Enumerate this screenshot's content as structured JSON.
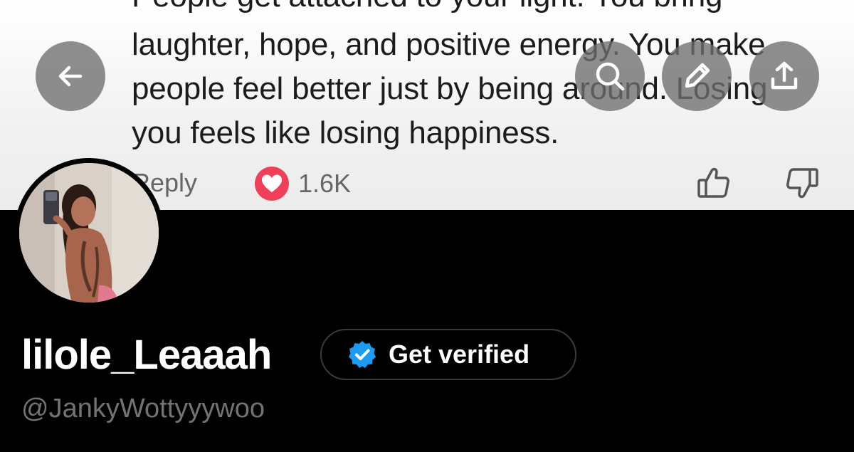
{
  "comment": {
    "lines": [
      "People get attached to your light. You bring",
      "laughter, hope, and positive energy. You make",
      "people feel better just by being around. Losing",
      "you feels like losing happiness."
    ],
    "reply_label": "Reply",
    "like_count": "1.6K",
    "heart_color": "#ef4059"
  },
  "header_actions": {
    "back_icon": "arrow-left-icon",
    "search_icon": "search-icon",
    "edit_icon": "pencil-icon",
    "share_icon": "share-icon"
  },
  "profile": {
    "display_name": "lilole_Leaaah",
    "handle": "@JankyWottyyywoo",
    "verify_label": "Get verified",
    "verified_badge_color": "#1d9bf0"
  }
}
